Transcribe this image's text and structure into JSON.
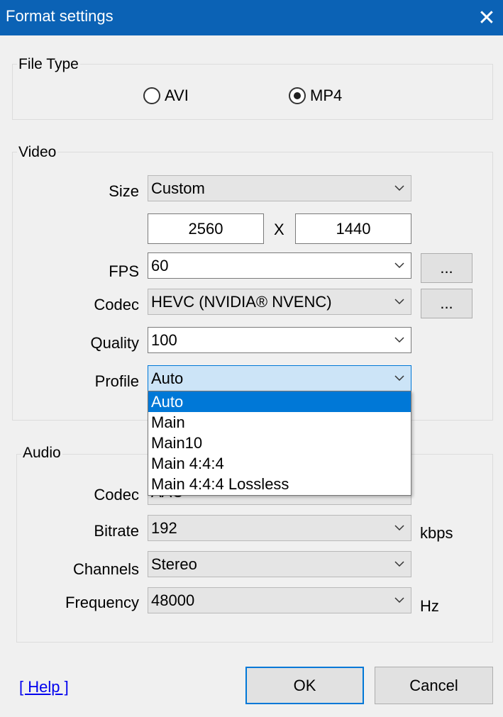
{
  "window": {
    "title": "Format settings",
    "close_icon": "close-icon"
  },
  "file_type": {
    "legend": "File Type",
    "options": [
      {
        "label": "AVI",
        "checked": false
      },
      {
        "label": "MP4",
        "checked": true
      }
    ]
  },
  "video": {
    "legend": "Video",
    "size_label": "Size",
    "size_value": "Custom",
    "width": "2560",
    "separator": "X",
    "height": "1440",
    "fps_label": "FPS",
    "fps_value": "60",
    "fps_more": "...",
    "codec_label": "Codec",
    "codec_value": "HEVC (NVIDIA® NVENC)",
    "codec_more": "...",
    "quality_label": "Quality",
    "quality_value": "100",
    "profile_label": "Profile",
    "profile_value": "Auto",
    "profile_options": [
      "Auto",
      "Main",
      "Main10",
      "Main 4:4:4",
      "Main 4:4:4 Lossless"
    ]
  },
  "audio": {
    "legend": "Audio",
    "codec_label": "Codec",
    "codec_value": "AAC",
    "bitrate_label": "Bitrate",
    "bitrate_value": "192",
    "bitrate_unit": "kbps",
    "channels_label": "Channels",
    "channels_value": "Stereo",
    "frequency_label": "Frequency",
    "frequency_value": "48000",
    "frequency_unit": "Hz"
  },
  "footer": {
    "help_link": "[ Help ]",
    "ok_label": "OK",
    "cancel_label": "Cancel"
  },
  "colors": {
    "titlebar": "#0b62b5",
    "selection": "#0078d7",
    "focus_fill": "#cce4f7"
  }
}
